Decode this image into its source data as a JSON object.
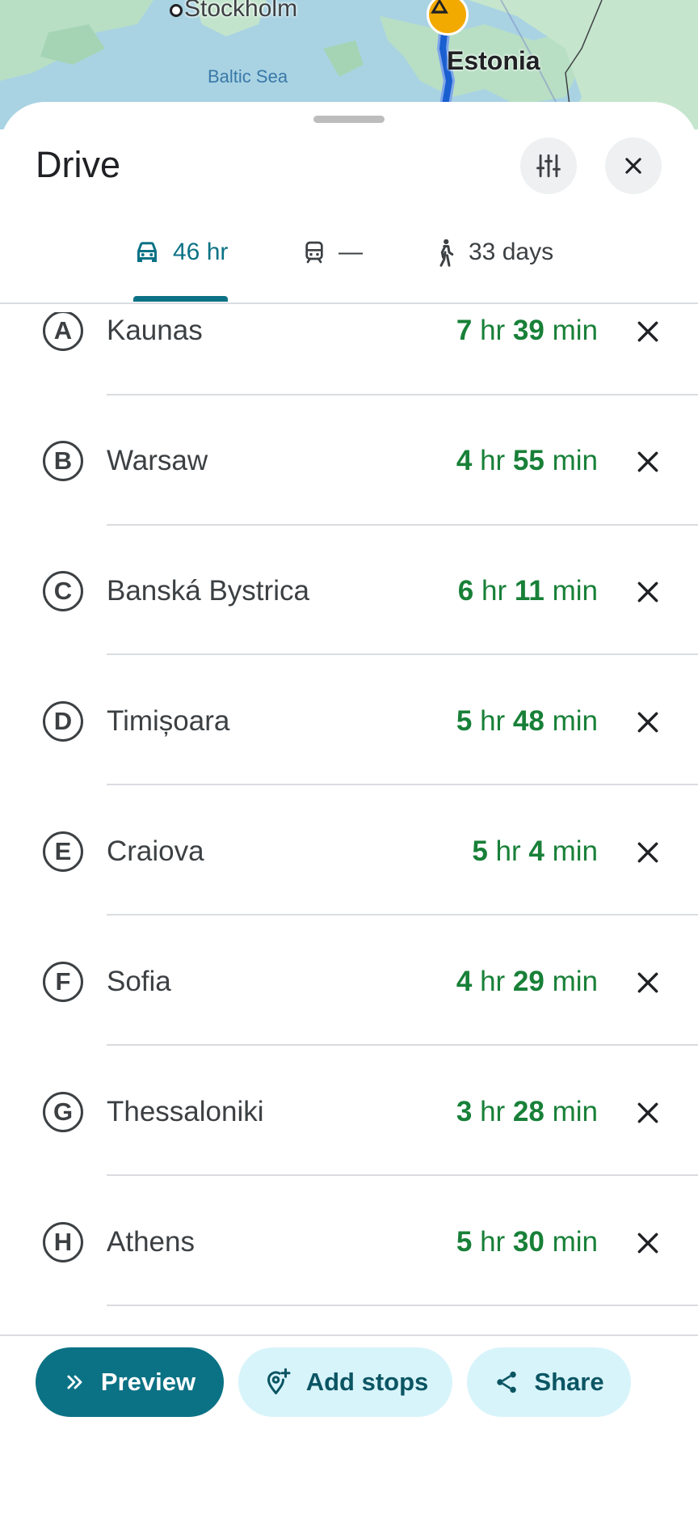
{
  "map": {
    "city_label": "Stockholm",
    "sea_label": "Baltic Sea",
    "country_label": "Estonia",
    "colors": {
      "water": "#a9d3e3",
      "land": "#b8dfc4",
      "route": "#1a5fd0"
    }
  },
  "sheet": {
    "title": "Drive"
  },
  "tabs": [
    {
      "mode": "drive",
      "label": "46 hr",
      "icon": "car-icon",
      "selected": true
    },
    {
      "mode": "transit",
      "label": "—",
      "icon": "train-icon",
      "selected": false
    },
    {
      "mode": "walk",
      "label": "33 days",
      "icon": "walking-icon",
      "selected": false
    }
  ],
  "stops": [
    {
      "marker": "A",
      "name": "Kaunas",
      "hr": "7",
      "hr_unit": "hr",
      "min": "39",
      "min_unit": "min"
    },
    {
      "marker": "B",
      "name": "Warsaw",
      "hr": "4",
      "hr_unit": "hr",
      "min": "55",
      "min_unit": "min"
    },
    {
      "marker": "C",
      "name": "Banská Bystrica",
      "hr": "6",
      "hr_unit": "hr",
      "min": "11",
      "min_unit": "min"
    },
    {
      "marker": "D",
      "name": "Timișoara",
      "hr": "5",
      "hr_unit": "hr",
      "min": "48",
      "min_unit": "min"
    },
    {
      "marker": "E",
      "name": "Craiova",
      "hr": "5",
      "hr_unit": "hr",
      "min": "4",
      "min_unit": "min"
    },
    {
      "marker": "F",
      "name": "Sofia",
      "hr": "4",
      "hr_unit": "hr",
      "min": "29",
      "min_unit": "min"
    },
    {
      "marker": "G",
      "name": "Thessaloniki",
      "hr": "3",
      "hr_unit": "hr",
      "min": "28",
      "min_unit": "min"
    },
    {
      "marker": "H",
      "name": "Athens",
      "hr": "5",
      "hr_unit": "hr",
      "min": "30",
      "min_unit": "min"
    }
  ],
  "actions": {
    "preview_label": "Preview",
    "add_stops_label": "Add stops",
    "share_label": "Share"
  },
  "colors": {
    "accent": "#0b7285",
    "duration_green": "#188038",
    "tonal_button": "#d8f4fb"
  }
}
